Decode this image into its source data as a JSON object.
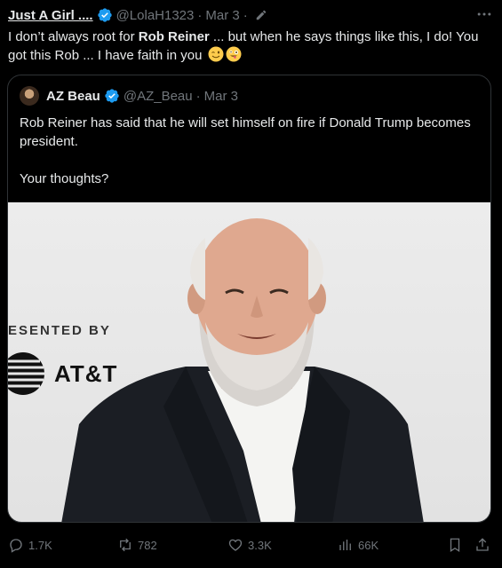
{
  "tweet": {
    "display_name": "Just A Girl ....",
    "handle": "@LolaH1323",
    "separator": "·",
    "time": "Mar 3",
    "separator2": "·",
    "text_part1": "I don’t always root for ",
    "text_bold": "Rob Reiner",
    "text_part2": " ... but when he says things like this, I do! You got this Rob ... I have faith in you",
    "icons": {
      "verified": "verified-badge-icon",
      "edit": "edit-pencil-icon",
      "more": "more-options-icon",
      "emoji1": "winking-face-emoji",
      "emoji2": "zany-face-emoji"
    }
  },
  "quote": {
    "display_name": "AZ Beau",
    "handle": "@AZ_Beau",
    "separator": "·",
    "time": "Mar 3",
    "text_line1": "Rob Reiner has said that he will set himself on fire if Donald Trump becomes president.",
    "text_line2": "Your thoughts?",
    "photo": {
      "backdrop_text": "ESENTED BY",
      "logo_text": "AT&T"
    }
  },
  "actions": {
    "reply_count": "1.7K",
    "repost_count": "782",
    "like_count": "3.3K",
    "views_count": "66K"
  },
  "colors": {
    "background": "#000000",
    "text": "#e7e9ea",
    "secondary": "#71767b",
    "verified": "#1d9bf0",
    "border": "#2f3336"
  }
}
